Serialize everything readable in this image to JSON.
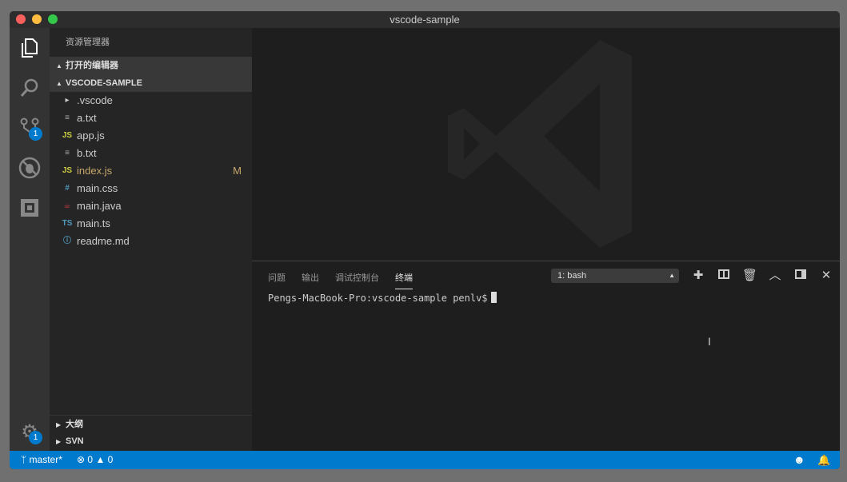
{
  "window": {
    "title": "vscode-sample"
  },
  "activity": {
    "scm_badge": "1",
    "settings_badge": "1"
  },
  "sidebar": {
    "title": "资源管理器",
    "open_editors": "打开的编辑器",
    "project": "VSCODE-SAMPLE",
    "files": [
      {
        "name": ".vscode",
        "icon": "chevron-right",
        "kind": "folder"
      },
      {
        "name": "a.txt",
        "icon": "≡",
        "kind": "txt"
      },
      {
        "name": "app.js",
        "icon": "JS",
        "kind": "js"
      },
      {
        "name": "b.txt",
        "icon": "≡",
        "kind": "txt"
      },
      {
        "name": "index.js",
        "icon": "JS",
        "kind": "js",
        "status": "M"
      },
      {
        "name": "main.css",
        "icon": "#",
        "kind": "css"
      },
      {
        "name": "main.java",
        "icon": "☕",
        "kind": "java"
      },
      {
        "name": "main.ts",
        "icon": "TS",
        "kind": "ts"
      },
      {
        "name": "readme.md",
        "icon": "ⓘ",
        "kind": "md"
      }
    ],
    "outline": "大纲",
    "svn": "SVN"
  },
  "panel": {
    "tabs": [
      "问题",
      "输出",
      "调试控制台",
      "终端"
    ],
    "terminal_select": "1: bash",
    "prompt": "Pengs-MacBook-Pro:vscode-sample penlv$"
  },
  "status": {
    "branch": "master*",
    "errors": "0",
    "warnings": "0"
  },
  "colors": {
    "accent": "#007acc",
    "modified": "#c8a86a",
    "js": "#cbcb41",
    "ts": "#519aba"
  }
}
